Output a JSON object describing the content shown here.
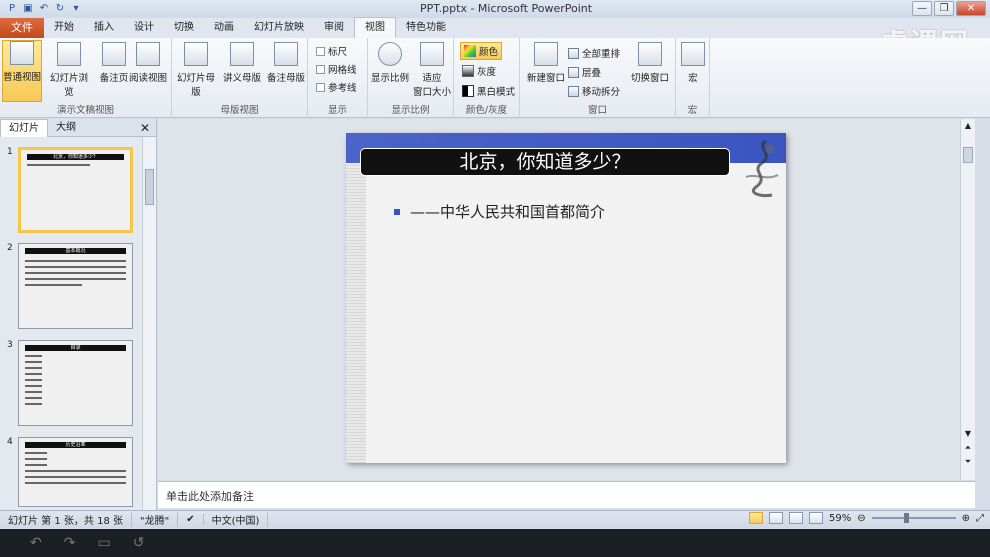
{
  "window": {
    "title": "PPT.pptx - Microsoft PowerPoint",
    "brand": "虎课网"
  },
  "quick_access": [
    "save-icon",
    "undo-icon",
    "redo-icon",
    "customize-icon"
  ],
  "window_controls": {
    "minimize": "—",
    "restore": "❐",
    "close": "✕"
  },
  "tabs": [
    "文件",
    "开始",
    "插入",
    "设计",
    "切换",
    "动画",
    "幻灯片放映",
    "审阅",
    "视图",
    "特色功能"
  ],
  "active_tab": "视图",
  "ribbon": {
    "presentation_views": {
      "label": "演示文稿视图",
      "items": [
        "普通视图",
        "幻灯片浏览",
        "备注页",
        "阅读视图"
      ]
    },
    "master_views": {
      "label": "母版视图",
      "items": [
        "幻灯片母版",
        "讲义母版",
        "备注母版"
      ]
    },
    "show": {
      "label": "显示",
      "items": [
        "标尺",
        "网格线",
        "参考线"
      ]
    },
    "zoom": {
      "label": "显示比例",
      "items": [
        "显示比例",
        "适应",
        "窗口大小"
      ]
    },
    "color": {
      "label": "颜色/灰度",
      "items": [
        "颜色",
        "灰度",
        "黑白模式"
      ]
    },
    "window": {
      "label": "窗口",
      "new_window": "新建窗口",
      "items": [
        "全部重排",
        "层叠",
        "移动拆分"
      ],
      "switch": "切换窗口"
    },
    "macros": {
      "label": "宏",
      "item": "宏"
    }
  },
  "left_panel": {
    "tabs": [
      "幻灯片",
      "大纲"
    ],
    "close": "✕",
    "thumbs": [
      {
        "num": "1",
        "title": "北京，你知道多少？"
      },
      {
        "num": "2",
        "title": "基本概况"
      },
      {
        "num": "3",
        "title": "目录"
      },
      {
        "num": "4",
        "title": "历史沿革"
      }
    ]
  },
  "slide": {
    "title": "北京，你知道多少？",
    "bullet": "——中华人民共和国首都简介"
  },
  "notes": {
    "placeholder": "单击此处添加备注"
  },
  "status": {
    "slide_info": "幻灯片 第 1 张，共 18 张",
    "theme": "\"龙腾\"",
    "language": "中文(中国)",
    "zoom": "59%"
  }
}
